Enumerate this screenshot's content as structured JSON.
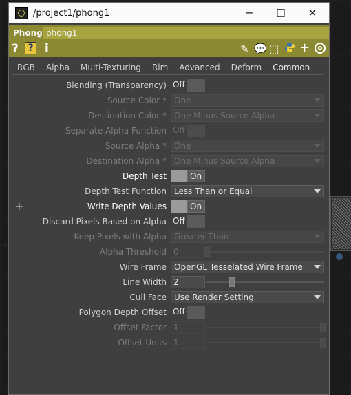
{
  "window": {
    "title": "/project1/phong1",
    "min_glyph": "─",
    "max_glyph": "☐",
    "close_glyph": "✕"
  },
  "operator": {
    "type": "Phong",
    "name": "phong1"
  },
  "toolbar": {
    "help": "?",
    "info": "i"
  },
  "tabs": [
    "RGB",
    "Alpha",
    "Multi-Texturing",
    "Rim",
    "Advanced",
    "Deform",
    "Common"
  ],
  "active_tab": "Common",
  "params": {
    "blending": {
      "label": "Blending (Transparency)",
      "state": "Off"
    },
    "source_color": {
      "label": "Source Color *",
      "value": "One"
    },
    "destination_color": {
      "label": "Destination Color *",
      "value": "One Minus Source Alpha"
    },
    "separate_alpha": {
      "label": "Separate Alpha Function",
      "state": "Off"
    },
    "source_alpha": {
      "label": "Source Alpha *",
      "value": "One"
    },
    "destination_alpha": {
      "label": "Destination Alpha *",
      "value": "One Minus Source Alpha"
    },
    "depth_test": {
      "label": "Depth Test",
      "state": "On"
    },
    "depth_test_function": {
      "label": "Depth Test Function",
      "value": "Less Than or Equal"
    },
    "write_depth_values": {
      "label": "Write Depth Values",
      "state": "On",
      "plus": "+"
    },
    "discard_pixels": {
      "label": "Discard Pixels Based on Alpha",
      "state": "Off"
    },
    "keep_pixels": {
      "label": "Keep Pixels with Alpha",
      "value": "Greater Than"
    },
    "alpha_threshold": {
      "label": "Alpha Threshold",
      "value": "0"
    },
    "wire_frame": {
      "label": "Wire Frame",
      "value": "OpenGL Tesselated Wire Frame"
    },
    "line_width": {
      "label": "Line Width",
      "value": "2"
    },
    "cull_face": {
      "label": "Cull Face",
      "value": "Use Render Setting"
    },
    "polygon_depth_offset": {
      "label": "Polygon Depth Offset",
      "state": "Off"
    },
    "offset_factor": {
      "label": "Offset Factor",
      "value": "1"
    },
    "offset_units": {
      "label": "Offset Units",
      "value": "1"
    }
  },
  "colors": {
    "header": "#8b8932",
    "name_field": "#a7a440",
    "panel": "#3f3f3f"
  },
  "icons": [
    "help-icon",
    "help-context-icon",
    "info-icon",
    "edit-icon",
    "comment-icon",
    "clone-icon",
    "python-icon",
    "add-icon",
    "target-icon"
  ]
}
